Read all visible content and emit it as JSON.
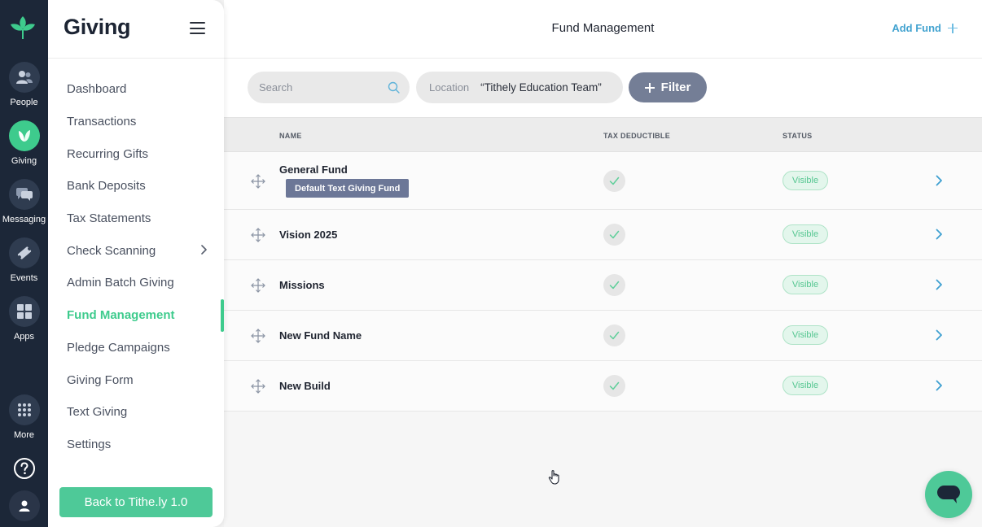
{
  "rail": {
    "items": [
      {
        "label": "People",
        "icon": "people-icon"
      },
      {
        "label": "Giving",
        "icon": "leaf-icon"
      },
      {
        "label": "Messaging",
        "icon": "chat-bubbles-icon"
      },
      {
        "label": "Events",
        "icon": "ticket-icon"
      },
      {
        "label": "Apps",
        "icon": "grid-icon"
      },
      {
        "label": "More",
        "icon": "dots-grid-icon"
      }
    ],
    "colors": {
      "background": "#1c2738",
      "active": "#3ecb8d"
    }
  },
  "sidebar": {
    "title": "Giving",
    "items": [
      {
        "label": "Dashboard"
      },
      {
        "label": "Transactions"
      },
      {
        "label": "Recurring Gifts"
      },
      {
        "label": "Bank Deposits"
      },
      {
        "label": "Tax Statements"
      },
      {
        "label": "Check Scanning"
      },
      {
        "label": "Admin Batch Giving"
      },
      {
        "label": "Fund Management"
      },
      {
        "label": "Pledge Campaigns"
      },
      {
        "label": "Giving Form"
      },
      {
        "label": "Text Giving"
      },
      {
        "label": "Settings"
      }
    ],
    "back_button": "Back to Tithe.ly 1.0"
  },
  "header": {
    "title": "Fund Management",
    "add_fund": "Add Fund"
  },
  "filters": {
    "search_placeholder": "Search",
    "location_label": "Location",
    "location_value": "“Tithely Education Team”",
    "filter_button": "Filter"
  },
  "table": {
    "columns": [
      "NAME",
      "TAX DEDUCTIBLE",
      "STATUS"
    ],
    "rows": [
      {
        "name": "General Fund",
        "badge": "Default Text Giving Fund",
        "tax_deductible": true,
        "status": "Visible"
      },
      {
        "name": "Vision 2025",
        "tax_deductible": true,
        "status": "Visible"
      },
      {
        "name": "Missions",
        "tax_deductible": true,
        "status": "Visible"
      },
      {
        "name": "New Fund Name",
        "tax_deductible": true,
        "status": "Visible"
      },
      {
        "name": "New Build",
        "tax_deductible": true,
        "status": "Visible"
      }
    ]
  },
  "colors": {
    "accent_green": "#3ecb8d",
    "link_blue": "#43a3d0",
    "filter_button": "#747e96",
    "badge": "#6c7797"
  }
}
